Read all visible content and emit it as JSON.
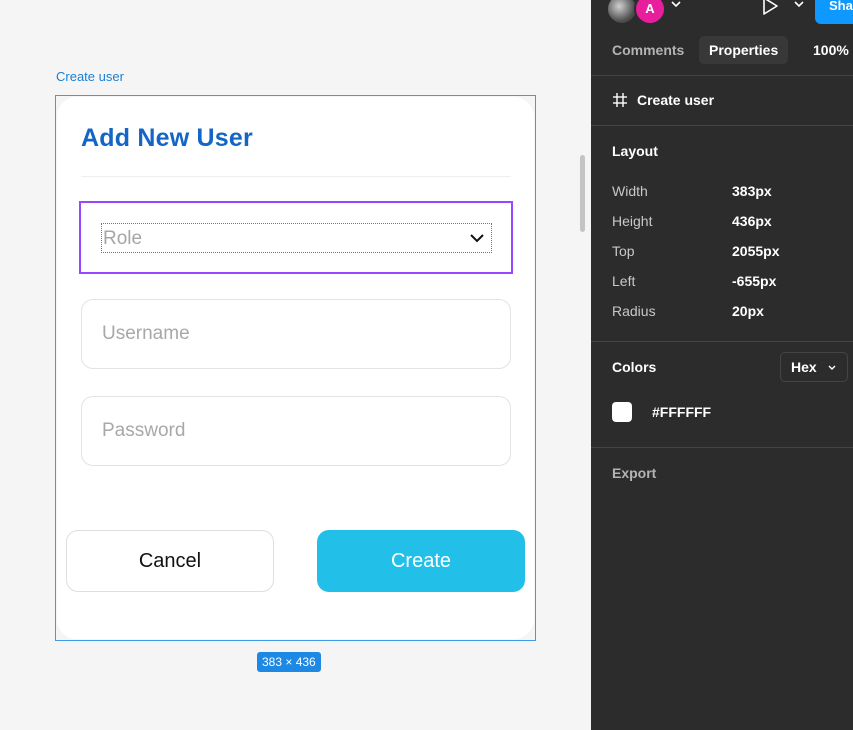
{
  "canvas": {
    "frame_label": "Create user",
    "size_badge": "383 × 436",
    "form": {
      "title": "Add New User",
      "role_placeholder": "Role",
      "username_placeholder": "Username",
      "password_placeholder": "Password",
      "cancel_label": "Cancel",
      "create_label": "Create"
    },
    "colors": {
      "title": "#1466C6",
      "create_button": "#22C0E8",
      "selection": "#9747FF",
      "frame_outline": "#3D9BE9"
    }
  },
  "panel": {
    "header": {
      "avatar_initial": "A",
      "share_label": "Share"
    },
    "tabs": [
      {
        "label": "Comments",
        "active": false
      },
      {
        "label": "Properties",
        "active": true
      }
    ],
    "zoom": "100%",
    "frame_name": "Create user",
    "layout": {
      "title": "Layout",
      "props": [
        {
          "label": "Width",
          "value": "383px"
        },
        {
          "label": "Height",
          "value": "436px"
        },
        {
          "label": "Top",
          "value": "2055px"
        },
        {
          "label": "Left",
          "value": "-655px"
        },
        {
          "label": "Radius",
          "value": "20px"
        }
      ]
    },
    "colors": {
      "title": "Colors",
      "format": "Hex",
      "fill": "#FFFFFF"
    },
    "export_title": "Export"
  }
}
